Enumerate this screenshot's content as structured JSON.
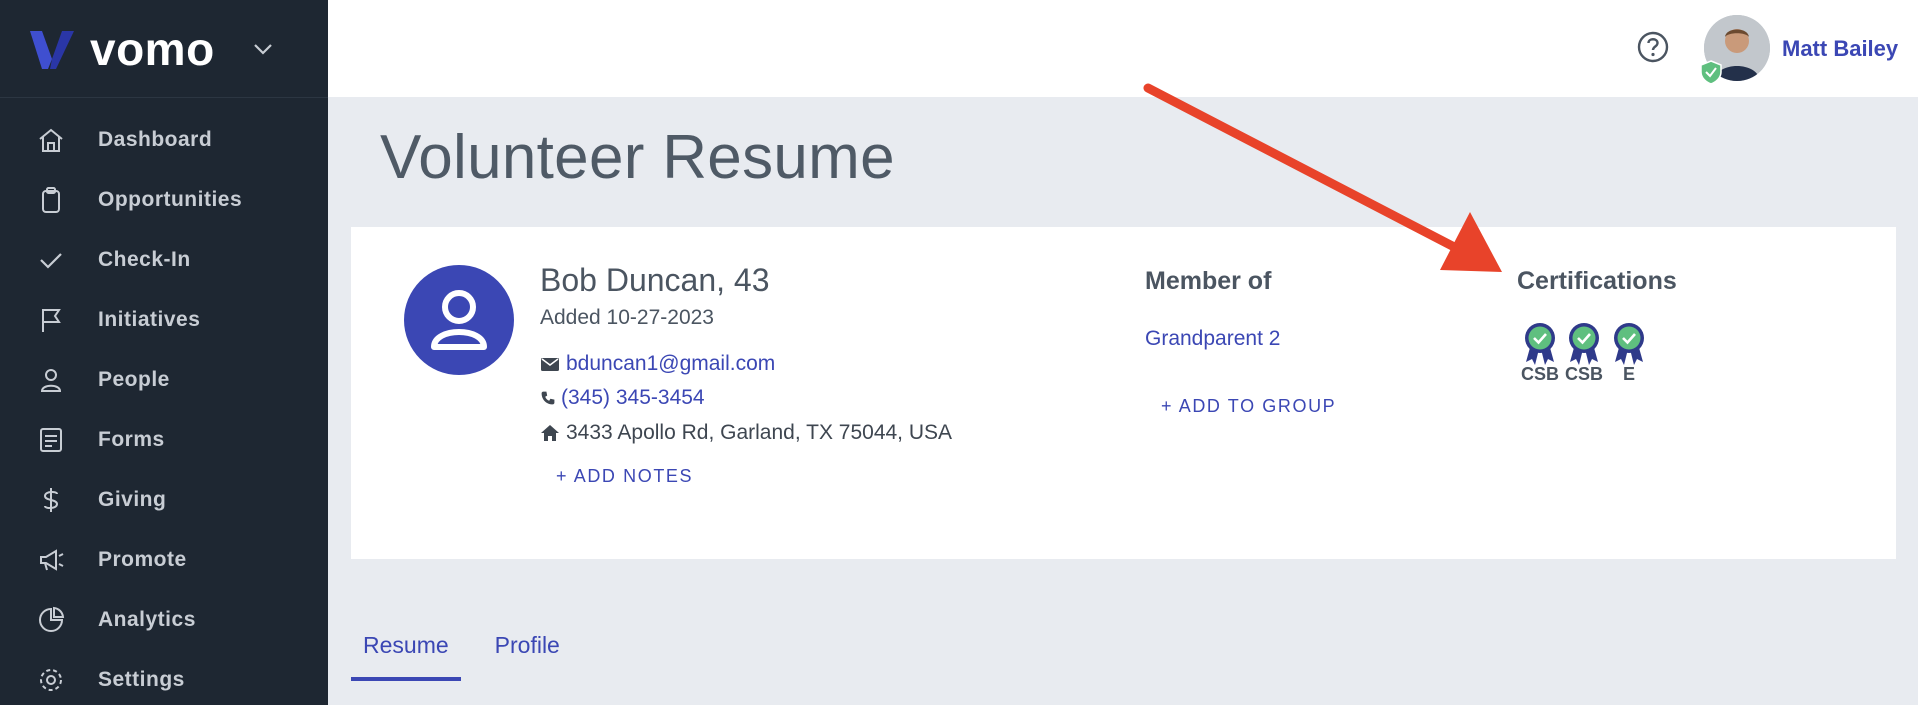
{
  "brand": {
    "name": "vomo"
  },
  "sidebar": {
    "items": [
      {
        "label": "Dashboard",
        "icon": "home-icon"
      },
      {
        "label": "Opportunities",
        "icon": "clipboard-icon"
      },
      {
        "label": "Check-In",
        "icon": "check-icon"
      },
      {
        "label": "Initiatives",
        "icon": "flag-icon"
      },
      {
        "label": "People",
        "icon": "person-icon"
      },
      {
        "label": "Forms",
        "icon": "form-icon"
      },
      {
        "label": "Giving",
        "icon": "dollar-icon"
      },
      {
        "label": "Promote",
        "icon": "megaphone-icon"
      },
      {
        "label": "Analytics",
        "icon": "pie-chart-icon"
      },
      {
        "label": "Settings",
        "icon": "gear-icon"
      }
    ]
  },
  "header": {
    "user_name": "Matt Bailey",
    "help_icon": "help-icon"
  },
  "page": {
    "title": "Volunteer Resume"
  },
  "profile": {
    "name": "Bob Duncan, 43",
    "added": "Added 10-27-2023",
    "email": "bduncan1@gmail.com",
    "phone": "(345) 345-3454",
    "address": "3433 Apollo Rd, Garland, TX 75044, USA",
    "add_notes": "+ ADD NOTES"
  },
  "membership": {
    "heading": "Member of",
    "groups": [
      "Grandparent 2"
    ],
    "add_group": "+ ADD TO GROUP"
  },
  "certifications": {
    "heading": "Certifications",
    "items": [
      {
        "label": "CSB"
      },
      {
        "label": "CSB"
      },
      {
        "label": "E"
      }
    ]
  },
  "tabs": [
    {
      "label": "Resume",
      "active": true
    },
    {
      "label": "Profile",
      "active": false
    }
  ],
  "colors": {
    "sidebar_bg": "#1e2732",
    "accent": "#3b47b4",
    "badge_green": "#5fbf7f",
    "arrow": "#e8432a"
  }
}
